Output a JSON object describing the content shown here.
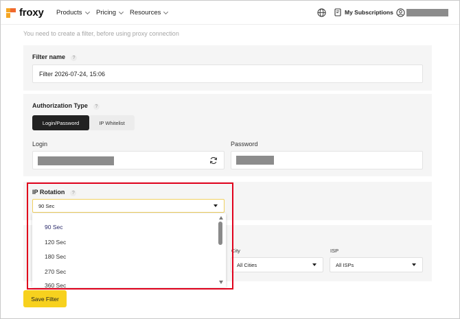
{
  "header": {
    "logo_text": "froxy",
    "nav": [
      {
        "label": "Products"
      },
      {
        "label": "Pricing"
      },
      {
        "label": "Resources"
      }
    ],
    "subscriptions_label": "My Subscriptions"
  },
  "note": "You need to create a filter, before using proxy connection",
  "filter_name": {
    "label": "Filter name",
    "help": "?",
    "value": "Filter 2026-07-24, 15:06"
  },
  "authorization": {
    "label": "Authorization Type",
    "help": "?",
    "options": [
      "Login/Password",
      "IP Whitelist"
    ],
    "selected": "Login/Password",
    "login_label": "Login",
    "password_label": "Password"
  },
  "ip_rotation": {
    "label": "IP Rotation",
    "help": "?",
    "selected": "90 Sec",
    "options": [
      "90 Sec",
      "120 Sec",
      "180 Sec",
      "270 Sec",
      "360 Sec"
    ]
  },
  "location": {
    "city_label": "City",
    "city_value": "All Cities",
    "isp_label": "ISP",
    "isp_value": "All ISPs"
  },
  "save_label": "Save Filter",
  "colors": {
    "accent": "#f7d11e",
    "dark_button": "#222222",
    "highlight": "#e0001b",
    "panel": "#f5f5f5"
  }
}
